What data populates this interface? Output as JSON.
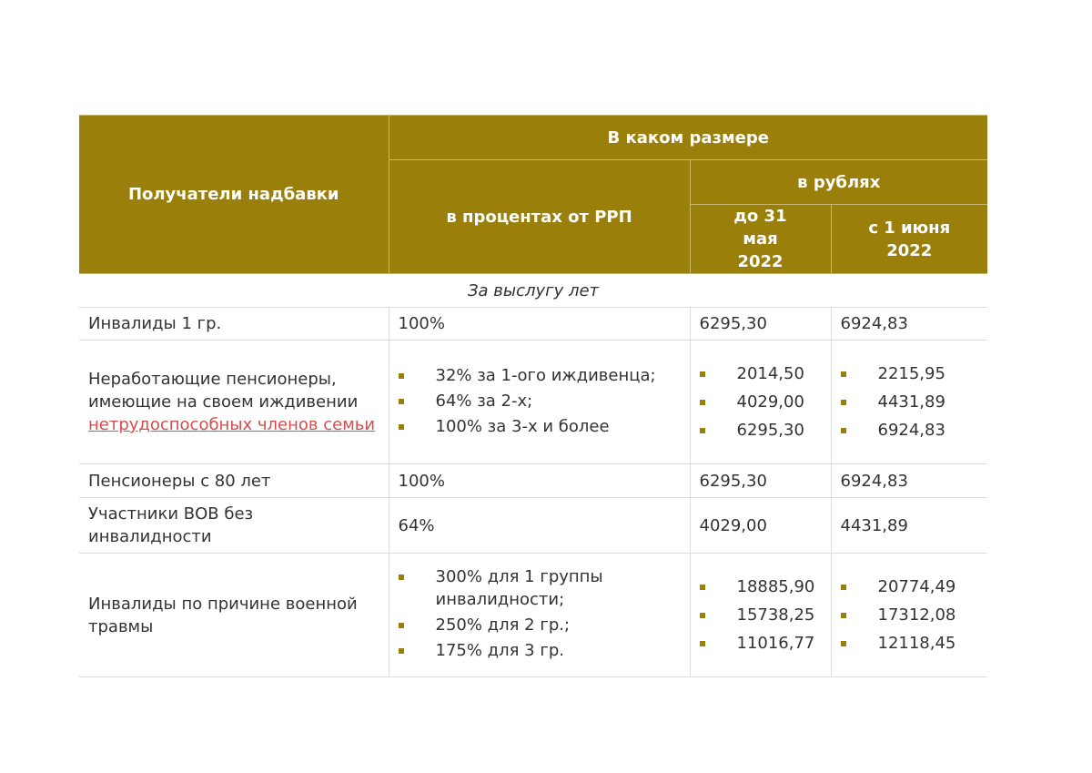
{
  "header": {
    "recipients": "Получатели надбавки",
    "amount": "В каком размере",
    "percent": "в процентах от РРП",
    "rubles": "в рублях",
    "until": "до 31 мая 2022",
    "from": "с 1 июня 2022"
  },
  "section_title": "За выслугу лет",
  "rows": {
    "r1": {
      "label": "Инвалиды 1 гр.",
      "percent": "100%",
      "until": "6295,30",
      "from": "6924,83"
    },
    "r2": {
      "label_text": "Неработающие пенсионеры, имеющие на своем иждивении",
      "label_link": "нетрудоспособных членов семьи",
      "percent": [
        "32% за 1-ого иждивенца;",
        "64% за 2-х;",
        "100% за 3-х и более"
      ],
      "until": [
        "2014,50",
        "4029,00",
        "6295,30"
      ],
      "from": [
        "2215,95",
        "4431,89",
        "6924,83"
      ]
    },
    "r3": {
      "label": "Пенсионеры с 80 лет",
      "percent": "100%",
      "until": "6295,30",
      "from": "6924,83"
    },
    "r4": {
      "label": "Участники ВОВ без инвалидности",
      "percent": "64%",
      "until": "4029,00",
      "from": "4431,89"
    },
    "r5": {
      "label": "Инвалиды по причине военной травмы",
      "percent": [
        "300% для 1 группы инвалидности;",
        "250% для 2 гр.;",
        "175% для 3 гр."
      ],
      "until": [
        "18885,90",
        "15738,25",
        "11016,77"
      ],
      "from": [
        "20774,49",
        "17312,08",
        "12118,45"
      ]
    }
  },
  "colors": {
    "header_bg": "#9b7f0b",
    "link": "#d64d4d"
  }
}
